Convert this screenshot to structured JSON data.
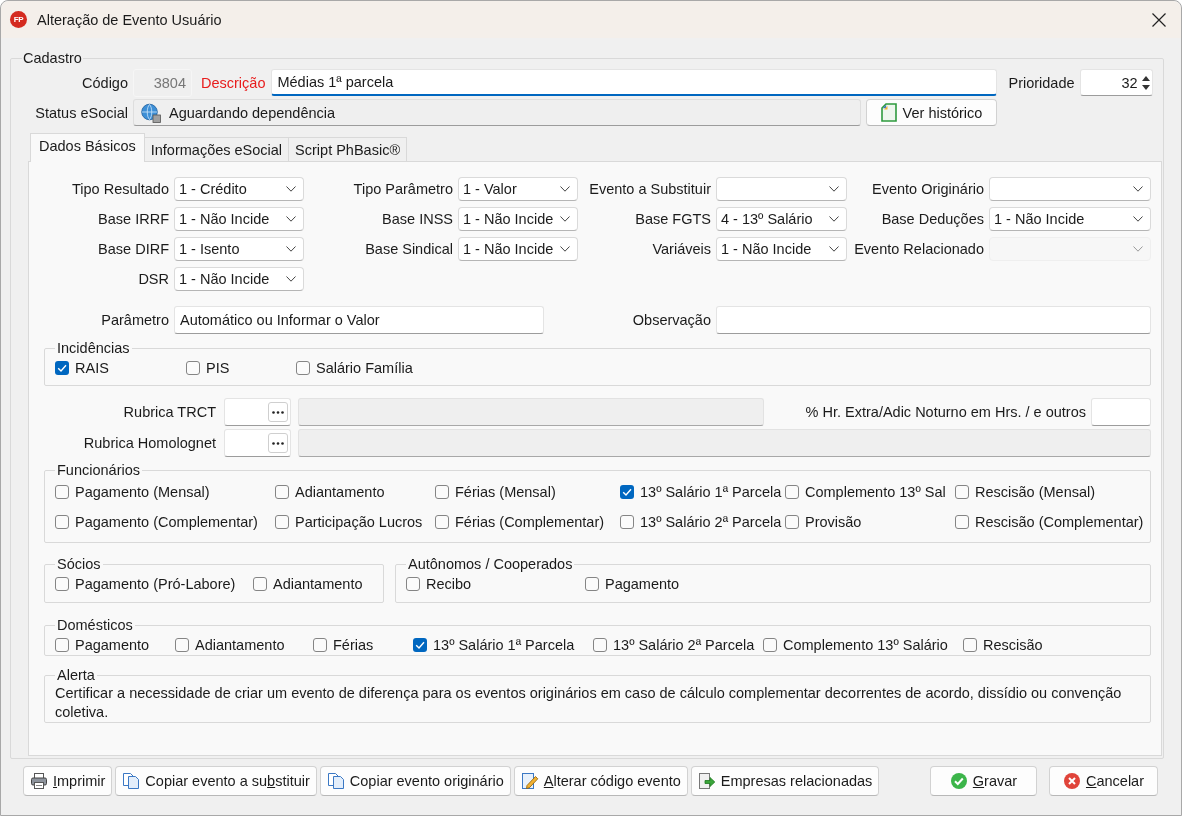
{
  "window": {
    "logo": "FP",
    "title": "Alteração de Evento Usuário"
  },
  "cadastro": {
    "title": "Cadastro",
    "code": {
      "label": "Código",
      "value": "3804",
      "readonly": true
    },
    "description": {
      "label": "Descrição",
      "value": "Médias 1ª parcela",
      "required": true,
      "focused": true
    },
    "priority": {
      "label": "Prioridade",
      "value": "32"
    },
    "status_esocial": {
      "label": "Status eSocial",
      "value": "Aguardando dependência"
    },
    "history_button": "Ver histórico"
  },
  "tabs": [
    {
      "label": "Dados Básicos",
      "selected": true
    },
    {
      "label": "Informações eSocial",
      "selected": false
    },
    {
      "label": "Script PhBasic®",
      "selected": false
    }
  ],
  "dados_basicos": {
    "field_rows": [
      [
        {
          "label": "Tipo Resultado",
          "value": "1 - Crédito",
          "disabled": false
        },
        {
          "label": "Tipo Parâmetro",
          "value": "1 - Valor",
          "disabled": false
        },
        {
          "label": "Evento a Substituir",
          "disabled": false
        },
        {
          "label": "Evento Originário",
          "disabled": false
        }
      ],
      [
        {
          "label": "Base IRRF",
          "value": "1 - Não Incide",
          "disabled": false
        },
        {
          "label": "Base INSS",
          "value": "1 - Não Incide",
          "disabled": false
        },
        {
          "label": "Base FGTS",
          "value": "4 - 13º Salário",
          "disabled": false
        },
        {
          "label": "Base Deduções",
          "value": "1 - Não Incide",
          "disabled": false
        }
      ],
      [
        {
          "label": "Base DIRF",
          "value": "1 - Isento",
          "disabled": false
        },
        {
          "label": "Base Sindical",
          "value": "1 - Não Incide",
          "disabled": false
        },
        {
          "label": "Variáveis",
          "value": "1 - Não Incide",
          "disabled": false
        },
        {
          "label": "Evento Relacionado",
          "disabled": true
        }
      ],
      [
        {
          "label": "DSR",
          "value": "1 - Não Incide",
          "disabled": false
        }
      ]
    ],
    "parametro": {
      "label": "Parâmetro",
      "value": "Automático ou Informar o Valor"
    },
    "observacao": {
      "label": "Observação"
    },
    "incidencias": {
      "title": "Incidências",
      "options": [
        {
          "label": "RAIS",
          "checked": true
        },
        {
          "label": "PIS",
          "checked": false
        },
        {
          "label": "Salário Família",
          "checked": false
        }
      ]
    },
    "rubrica_trct": {
      "label": "Rubrica TRCT"
    },
    "hr_extra": {
      "label": "% Hr. Extra/Adic Noturno em Hrs. / e outros"
    },
    "rubrica_homolognet": {
      "label": "Rubrica Homolognet"
    },
    "funcionarios": {
      "title": "Funcionários",
      "options": [
        {
          "label": "Pagamento (Mensal)",
          "checked": false
        },
        {
          "label": "Adiantamento",
          "checked": false
        },
        {
          "label": "Férias (Mensal)",
          "checked": false
        },
        {
          "label": "13º Salário 1ª Parcela",
          "checked": true
        },
        {
          "label": "Complemento 13º Sal",
          "checked": false
        },
        {
          "label": "Rescisão (Mensal)",
          "checked": false
        },
        {
          "label": "Pagamento (Complementar)",
          "checked": false
        },
        {
          "label": "Participação Lucros",
          "checked": false
        },
        {
          "label": "Férias (Complementar)",
          "checked": false
        },
        {
          "label": "13º Salário 2ª Parcela",
          "checked": false
        },
        {
          "label": "Provisão",
          "checked": false
        },
        {
          "label": "Rescisão (Complementar)",
          "checked": false
        }
      ]
    },
    "socios": {
      "title": "Sócios",
      "options": [
        {
          "label": "Pagamento (Pró-Labore)",
          "checked": false
        },
        {
          "label": "Adiantamento",
          "checked": false
        }
      ]
    },
    "autonomos": {
      "title": "Autônomos / Cooperados",
      "options": [
        {
          "label": "Recibo",
          "checked": false
        },
        {
          "label": "Pagamento",
          "checked": false
        }
      ]
    },
    "domesticos": {
      "title": "Domésticos",
      "options": [
        {
          "label": "Pagamento",
          "checked": false
        },
        {
          "label": "Adiantamento",
          "checked": false
        },
        {
          "label": "Férias",
          "checked": false
        },
        {
          "label": "13º Salário 1ª Parcela",
          "checked": true
        },
        {
          "label": "13º Salário 2ª Parcela",
          "checked": false
        },
        {
          "label": "Complemento 13º Salário",
          "checked": false
        },
        {
          "label": "Rescisão",
          "checked": false
        }
      ]
    },
    "alerta": {
      "title": "Alerta",
      "text": "Certificar a necessidade de criar um evento de diferença para os eventos originários em caso de cálculo complementar decorrentes de acordo, dissídio ou convenção coletiva."
    }
  },
  "actions": [
    {
      "kind": "print",
      "access_key": "I",
      "label_rest": "mprimir"
    },
    {
      "kind": "copy",
      "label": "Copiar evento a su",
      "access_key": "b",
      "label_rest": "stituir"
    },
    {
      "kind": "copy",
      "label": "Copiar evento originário"
    },
    {
      "kind": "edit",
      "access_key": "A",
      "label_rest": "lterar código evento"
    },
    {
      "kind": "export",
      "label": "Empresas relacionadas"
    }
  ],
  "dialog_buttons": [
    {
      "kind": "confirm",
      "access_key": "G",
      "label_rest": "ravar"
    },
    {
      "kind": "cancel",
      "access_key": "C",
      "label_rest": "ancelar"
    }
  ]
}
